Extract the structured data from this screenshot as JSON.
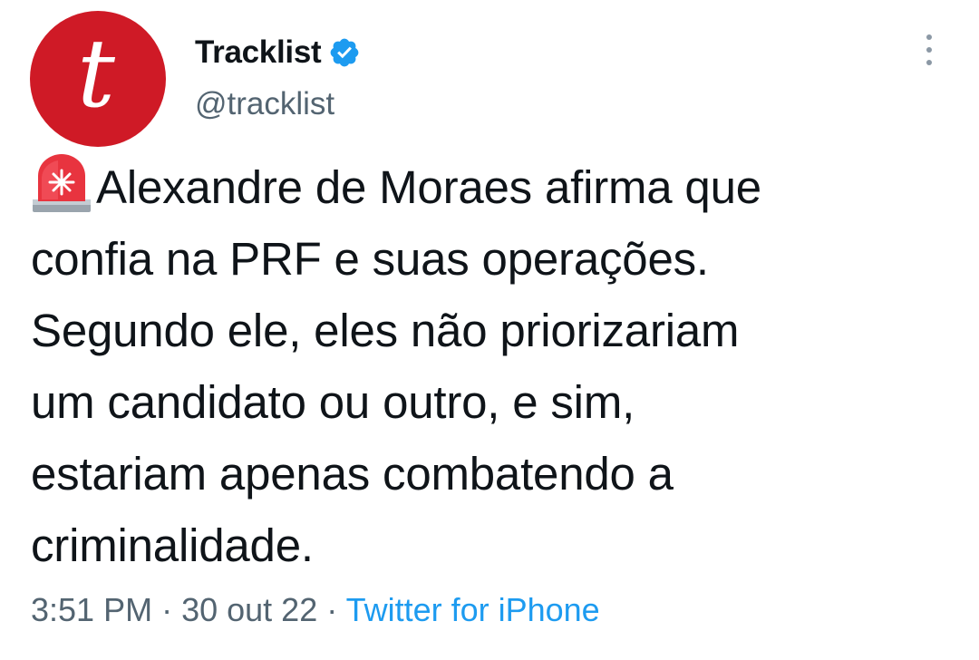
{
  "author": {
    "avatar_letter": "t",
    "display_name": "Tracklist",
    "handle": "@tracklist",
    "verified": true
  },
  "tweet": {
    "emoji": "police-car-light-icon",
    "text": "Alexandre de Moraes afirma que\nconfia na PRF e suas operações.\nSegundo ele, eles não priorizariam\num candidato ou outro, e sim,\nestariam apenas combatendo a\ncriminalidade."
  },
  "meta": {
    "time": "3:51 PM",
    "separator": " · ",
    "date": "30 out 22",
    "source": "Twitter for iPhone"
  },
  "colors": {
    "avatar_bg": "#cf1a26",
    "verified": "#1d9bf0",
    "link": "#1d9bf0",
    "secondary_text": "#536471",
    "primary_text": "#0f1419"
  }
}
